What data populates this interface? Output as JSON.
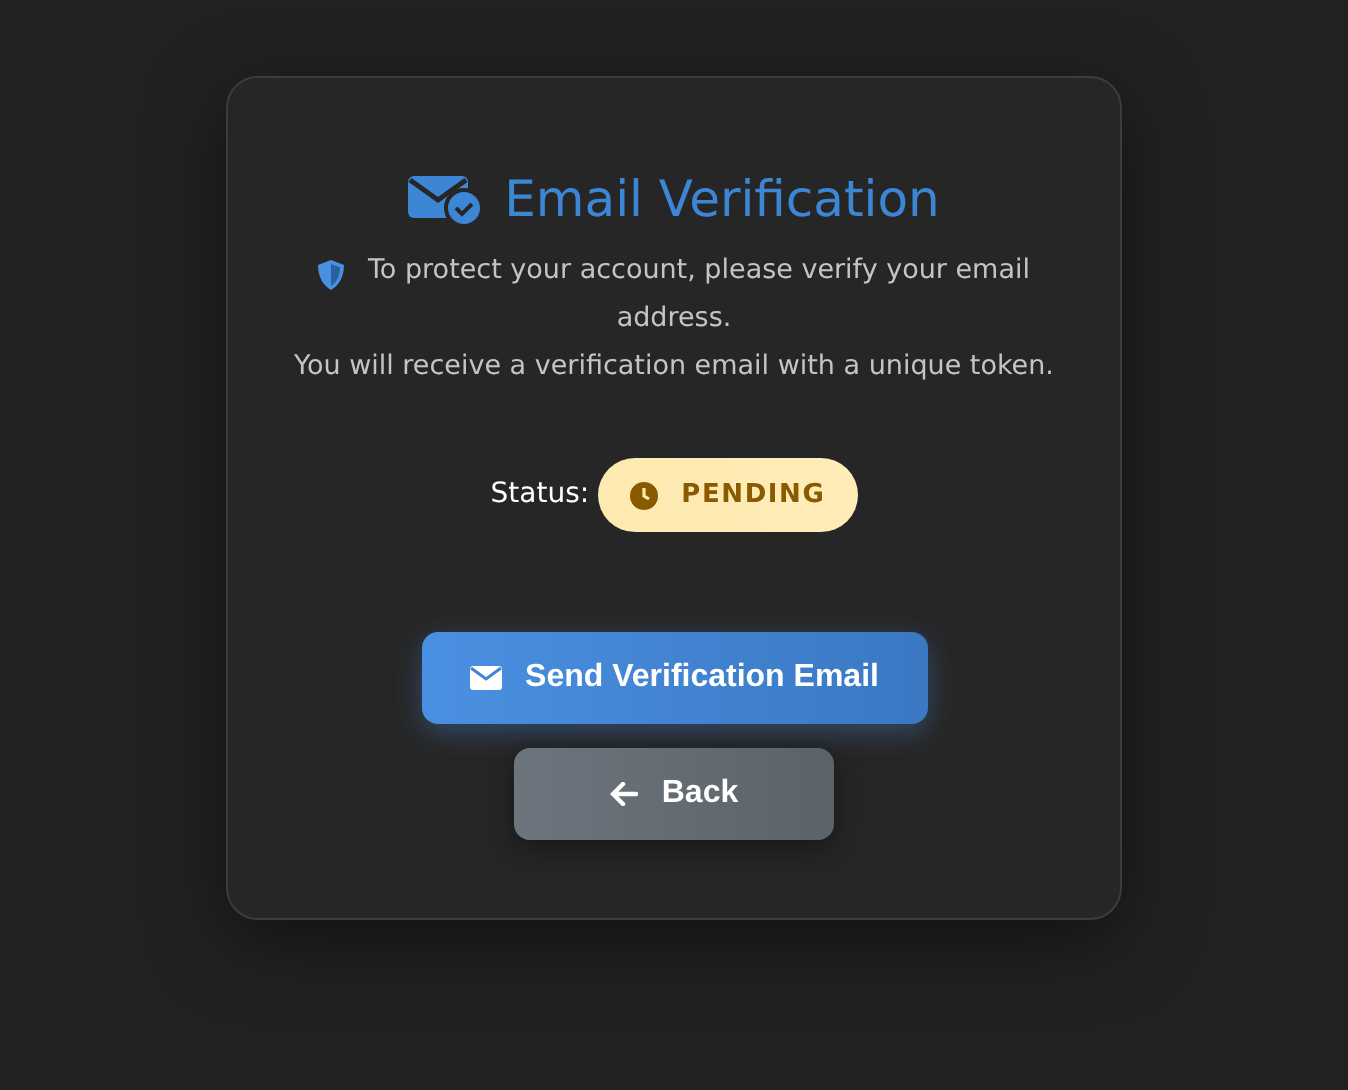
{
  "title": "Email Verification",
  "description": [
    "To protect your account, please verify your email address.",
    "You will receive a verification email with a unique token."
  ],
  "status": {
    "label": "Status:",
    "value": "PENDING",
    "kind": "pending"
  },
  "buttons": [
    {
      "label": "Send Verification Email",
      "kind": "send"
    },
    {
      "label": "Back",
      "kind": "back"
    }
  ]
}
